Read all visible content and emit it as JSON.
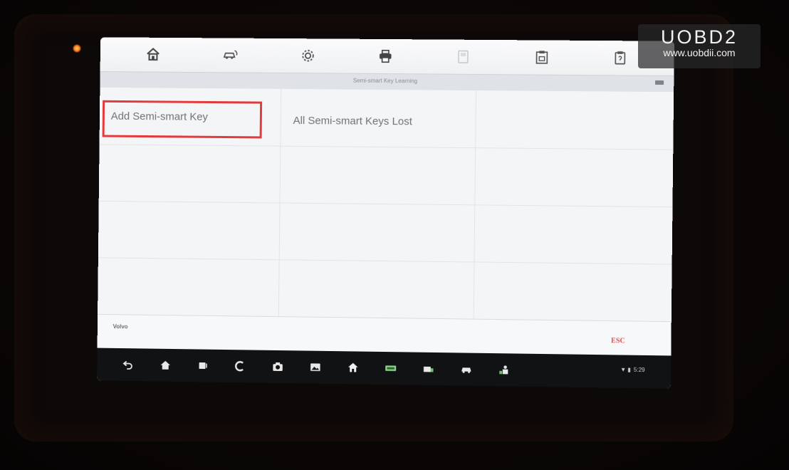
{
  "watermark": {
    "brand": "UOBD2",
    "url": "www.uobdii.com"
  },
  "toolbar": {
    "icons": [
      "home-icon",
      "vehicle-swap-icon",
      "settings-icon",
      "print-icon",
      "save-icon-disabled",
      "data-logging-icon",
      "help-icon"
    ]
  },
  "title_bar": {
    "title": "Semi-smart Key Learning"
  },
  "menu": {
    "items": [
      {
        "label": "Add Semi-smart Key",
        "selected": true
      },
      {
        "label": "All Semi-smart Keys Lost",
        "selected": false
      }
    ]
  },
  "footer": {
    "vehicle": "Volvo",
    "esc_label": "ESC"
  },
  "navbar": {
    "icons": [
      "back-icon",
      "android-home-icon",
      "recent-apps-icon",
      "browser-icon",
      "camera-icon",
      "gallery-icon",
      "maxisys-home-icon",
      "vci-icon",
      "vehicle-menu-icon",
      "car-icon",
      "user-icon"
    ],
    "status_time": "5:29"
  },
  "colors": {
    "highlight": "#e23b3b",
    "esc": "#e05050"
  }
}
